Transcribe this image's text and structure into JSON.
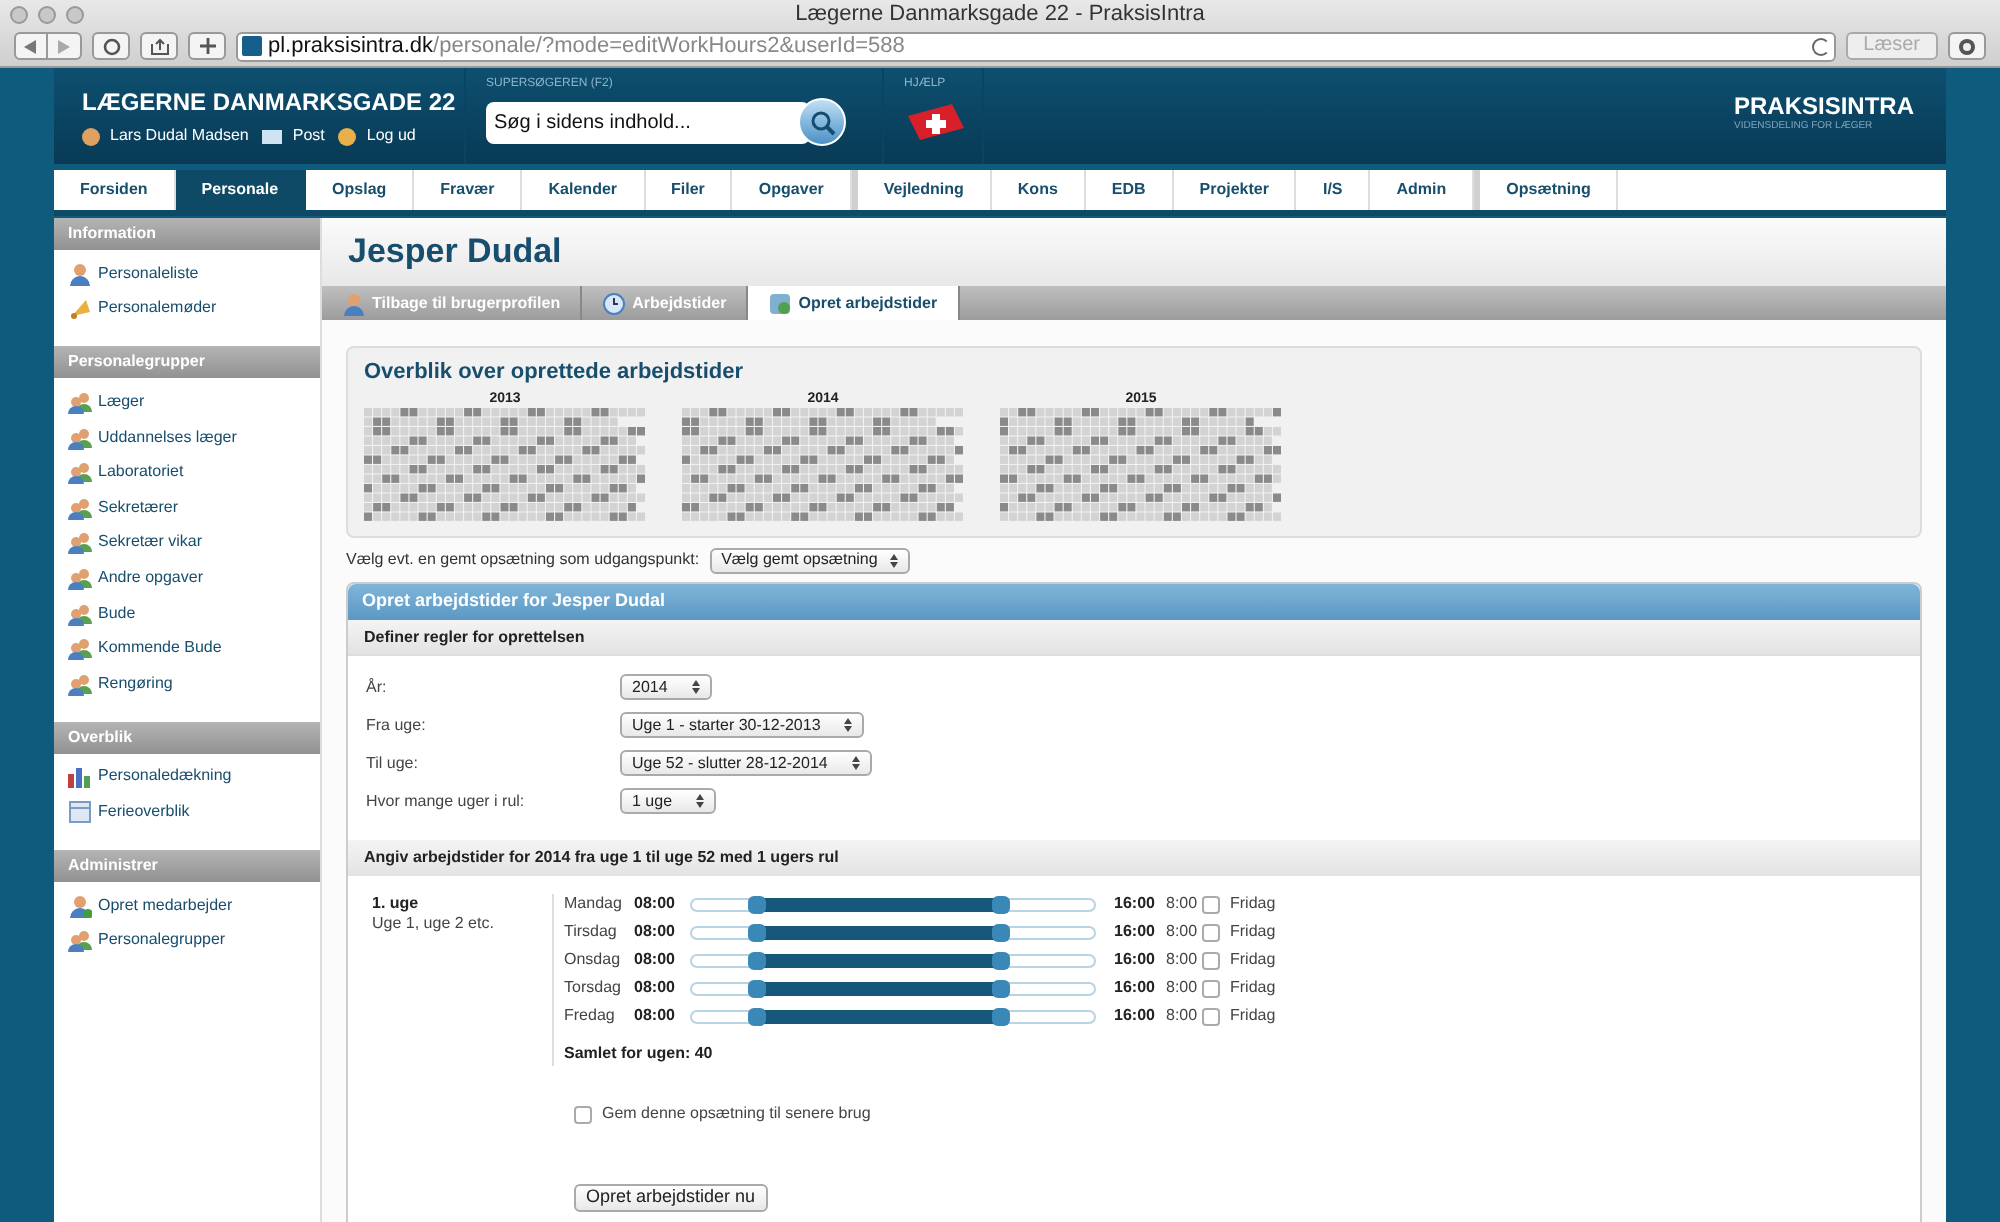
{
  "browser": {
    "title": "Lægerne Danmarksgade 22 - PraksisIntra",
    "url_host": "pl.praksisintra.dk",
    "url_path": "/personale/?mode=editWorkHours2&userId=588",
    "reader": "Læser"
  },
  "header": {
    "clinic": "LÆGERNE DANMARKSGADE 22",
    "user": "Lars Dudal Madsen",
    "post": "Post",
    "logout": "Log ud",
    "search_label": "SUPERSØGEREN (F2)",
    "search_placeholder": "Søg i sidens indhold...",
    "help_label": "HJÆLP",
    "logo": "PRAKSISINTRA",
    "tagline": "VIDENSDELING FOR LÆGER"
  },
  "nav": [
    {
      "label": "Forsiden",
      "selected": false,
      "divider_before": false
    },
    {
      "label": "Personale",
      "selected": true,
      "divider_before": false
    },
    {
      "label": "Opslag",
      "selected": false,
      "divider_before": false
    },
    {
      "label": "Fravær",
      "selected": false,
      "divider_before": false
    },
    {
      "label": "Kalender",
      "selected": false,
      "divider_before": false
    },
    {
      "label": "Filer",
      "selected": false,
      "divider_before": false
    },
    {
      "label": "Opgaver",
      "selected": false,
      "divider_before": false
    },
    {
      "label": "Vejledning",
      "selected": false,
      "divider_before": true
    },
    {
      "label": "Kons",
      "selected": false,
      "divider_before": false
    },
    {
      "label": "EDB",
      "selected": false,
      "divider_before": false
    },
    {
      "label": "Projekter",
      "selected": false,
      "divider_before": false
    },
    {
      "label": "I/S",
      "selected": false,
      "divider_before": false
    },
    {
      "label": "Admin",
      "selected": false,
      "divider_before": false
    },
    {
      "label": "Opsætning",
      "selected": false,
      "divider_before": true
    }
  ],
  "sidebar": [
    {
      "title": "Information",
      "items": [
        {
          "label": "Personaleliste",
          "kind": "person"
        },
        {
          "label": "Personalemøder",
          "kind": "bell"
        }
      ]
    },
    {
      "title": "Personalegrupper",
      "items": [
        {
          "label": "Læger",
          "kind": "group"
        },
        {
          "label": "Uddannelses læger",
          "kind": "group"
        },
        {
          "label": "Laboratoriet",
          "kind": "group"
        },
        {
          "label": "Sekretærer",
          "kind": "group"
        },
        {
          "label": "Sekretær vikar",
          "kind": "group"
        },
        {
          "label": "Andre opgaver",
          "kind": "group"
        },
        {
          "label": "Bude",
          "kind": "group"
        },
        {
          "label": "Kommende Bude",
          "kind": "group"
        },
        {
          "label": "Rengøring",
          "kind": "group"
        }
      ]
    },
    {
      "title": "Overblik",
      "items": [
        {
          "label": "Personaledækning",
          "kind": "chart"
        },
        {
          "label": "Ferieoverblik",
          "kind": "calendar"
        }
      ]
    },
    {
      "title": "Administrer",
      "items": [
        {
          "label": "Opret medarbejder",
          "kind": "person-add"
        },
        {
          "label": "Personalegrupper",
          "kind": "group"
        }
      ]
    }
  ],
  "page_title": "Jesper Dudal",
  "subtabs": [
    {
      "label": "Tilbage til brugerprofilen",
      "kind": "person",
      "selected": false
    },
    {
      "label": "Arbejdstider",
      "kind": "clock",
      "selected": false
    },
    {
      "label": "Opret arbejdstider",
      "kind": "add",
      "selected": true
    }
  ],
  "overview": {
    "title": "Overblik over oprettede arbejdstider",
    "years": [
      {
        "label": "2013"
      },
      {
        "label": "2014"
      },
      {
        "label": "2015"
      }
    ]
  },
  "setup": {
    "label": "Vælg evt. en gemt opsætning som udgangspunkt:",
    "select": "Vælg gemt opsætning"
  },
  "form": {
    "title": "Opret arbejdstider for Jesper Dudal",
    "rules_header": "Definer regler for oprettelsen",
    "fields": [
      {
        "label": "År:",
        "value": "2014"
      },
      {
        "label": "Fra uge:",
        "value": "Uge 1 - starter 30-12-2013"
      },
      {
        "label": "Til uge:",
        "value": "Uge 52 - slutter 28-12-2014"
      },
      {
        "label": "Hvor mange uger i rul:",
        "value": "1 uge"
      }
    ],
    "hours_header": "Angiv arbejdstider for 2014 fra uge 1 til uge 52 med 1 ugers rul",
    "week_title": "1. uge",
    "week_subtitle": "Uge 1, uge 2 etc.",
    "days": [
      {
        "day": "Mandag",
        "start": "08:00",
        "end": "16:00",
        "hours": "8:00",
        "level": 0.77,
        "day_off": false,
        "day_off_label": "Fridag"
      },
      {
        "day": "Tirsdag",
        "start": "08:00",
        "end": "16:00",
        "hours": "8:00",
        "level": 0.77,
        "day_off": false,
        "day_off_label": "Fridag"
      },
      {
        "day": "Onsdag",
        "start": "08:00",
        "end": "16:00",
        "hours": "8:00",
        "level": 0.77,
        "day_off": false,
        "day_off_label": "Fridag"
      },
      {
        "day": "Torsdag",
        "start": "08:00",
        "end": "16:00",
        "hours": "8:00",
        "level": 0.77,
        "day_off": false,
        "day_off_label": "Fridag"
      },
      {
        "day": "Fredag",
        "start": "08:00",
        "end": "16:00",
        "hours": "8:00",
        "level": 0.77,
        "day_off": false,
        "day_off_label": "Fridag"
      }
    ],
    "total": "Samlet for ugen: 40",
    "save": {
      "label": "Gem denne opsætning til senere brug",
      "checked": false
    },
    "submit": "Opret arbejdstider nu"
  }
}
